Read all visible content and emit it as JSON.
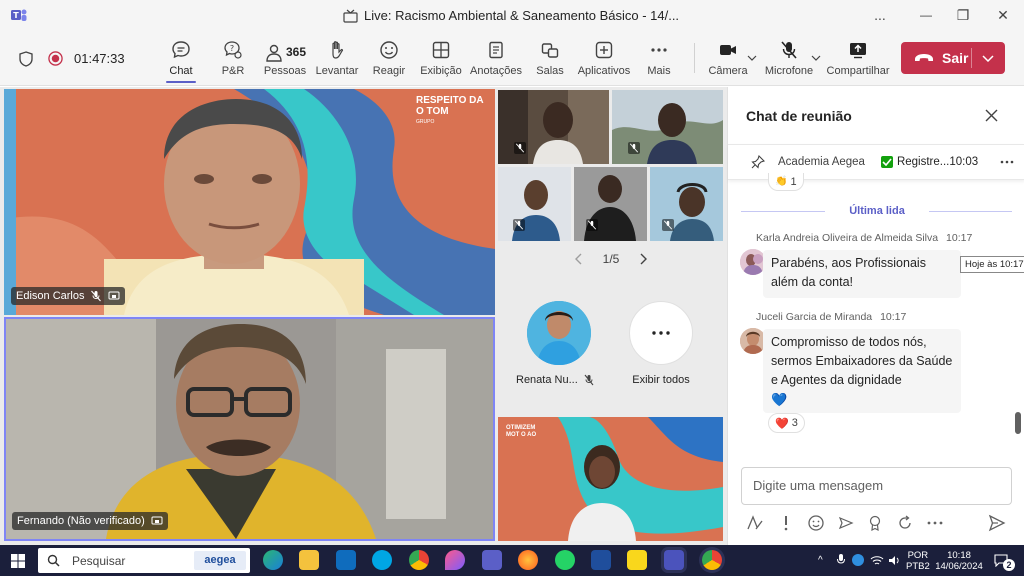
{
  "window": {
    "title": "Live: Racismo Ambiental & Saneamento Básico - 14/...",
    "more": "...",
    "minimize": "—",
    "restore": "❐",
    "close": "✕"
  },
  "toolbar": {
    "timer": "01:47:33",
    "items": [
      {
        "label": "Chat",
        "icon": "chat-icon"
      },
      {
        "label": "P&R",
        "icon": "question-icon"
      },
      {
        "label": "Pessoas",
        "icon": "people-icon",
        "count": "365"
      },
      {
        "label": "Levantar",
        "icon": "hand-icon"
      },
      {
        "label": "Reagir",
        "icon": "smile-icon"
      },
      {
        "label": "Exibição",
        "icon": "grid-icon"
      },
      {
        "label": "Anotações",
        "icon": "notes-icon"
      },
      {
        "label": "Salas",
        "icon": "rooms-icon"
      },
      {
        "label": "Aplicativos",
        "icon": "plus-icon"
      },
      {
        "label": "Mais",
        "icon": "more-icon"
      },
      {
        "label": "Câmera",
        "icon": "camera-icon"
      },
      {
        "label": "Microfone",
        "icon": "mic-off-icon"
      },
      {
        "label": "Compartilhar",
        "icon": "share-icon"
      }
    ],
    "leave_label": "Sair",
    "leave_color": "#c4314b",
    "accent": "#5b5fc7"
  },
  "stage": {
    "tile1": {
      "banner": "RESPEITO DA O TOM",
      "banner_sub": "GRUPO",
      "name": "Edison Carlos"
    },
    "tile2": {
      "name": "Fernando (Não verificado)"
    },
    "pager": "1/5",
    "renata": "Renata Nu...",
    "show_all": "Exibir todos",
    "tile_bottom_banner": "OTIMIZEM MOT O AO"
  },
  "chat": {
    "title": "Chat de reunião",
    "pinned_sender": "Academia Aegea",
    "pinned_text": "Registre...",
    "pinned_time": "10:03",
    "last_read": "Última lida",
    "top_reaction_count": "1",
    "messages": [
      {
        "sender": "Karla Andreia Oliveira de Almeida Silva",
        "time": "10:17",
        "text": "Parabéns, aos Profissionais além da conta!",
        "tooltip": "Hoje às 10:17"
      },
      {
        "sender": "Juceli Garcia de Miranda",
        "time": "10:17",
        "text": "Compromisso de todos nós, sermos Embaixadores da Saúde e Agentes da dignidade",
        "emoji": "💙",
        "reaction": "❤️",
        "reaction_count": "3"
      }
    ],
    "composer_placeholder": "Digite uma mensagem"
  },
  "taskbar": {
    "search_placeholder": "Pesquisar",
    "search_badge": "aegea",
    "lang1": "POR",
    "lang2": "PTB2",
    "time": "10:18",
    "date": "14/06/2024",
    "notifications": "2"
  }
}
